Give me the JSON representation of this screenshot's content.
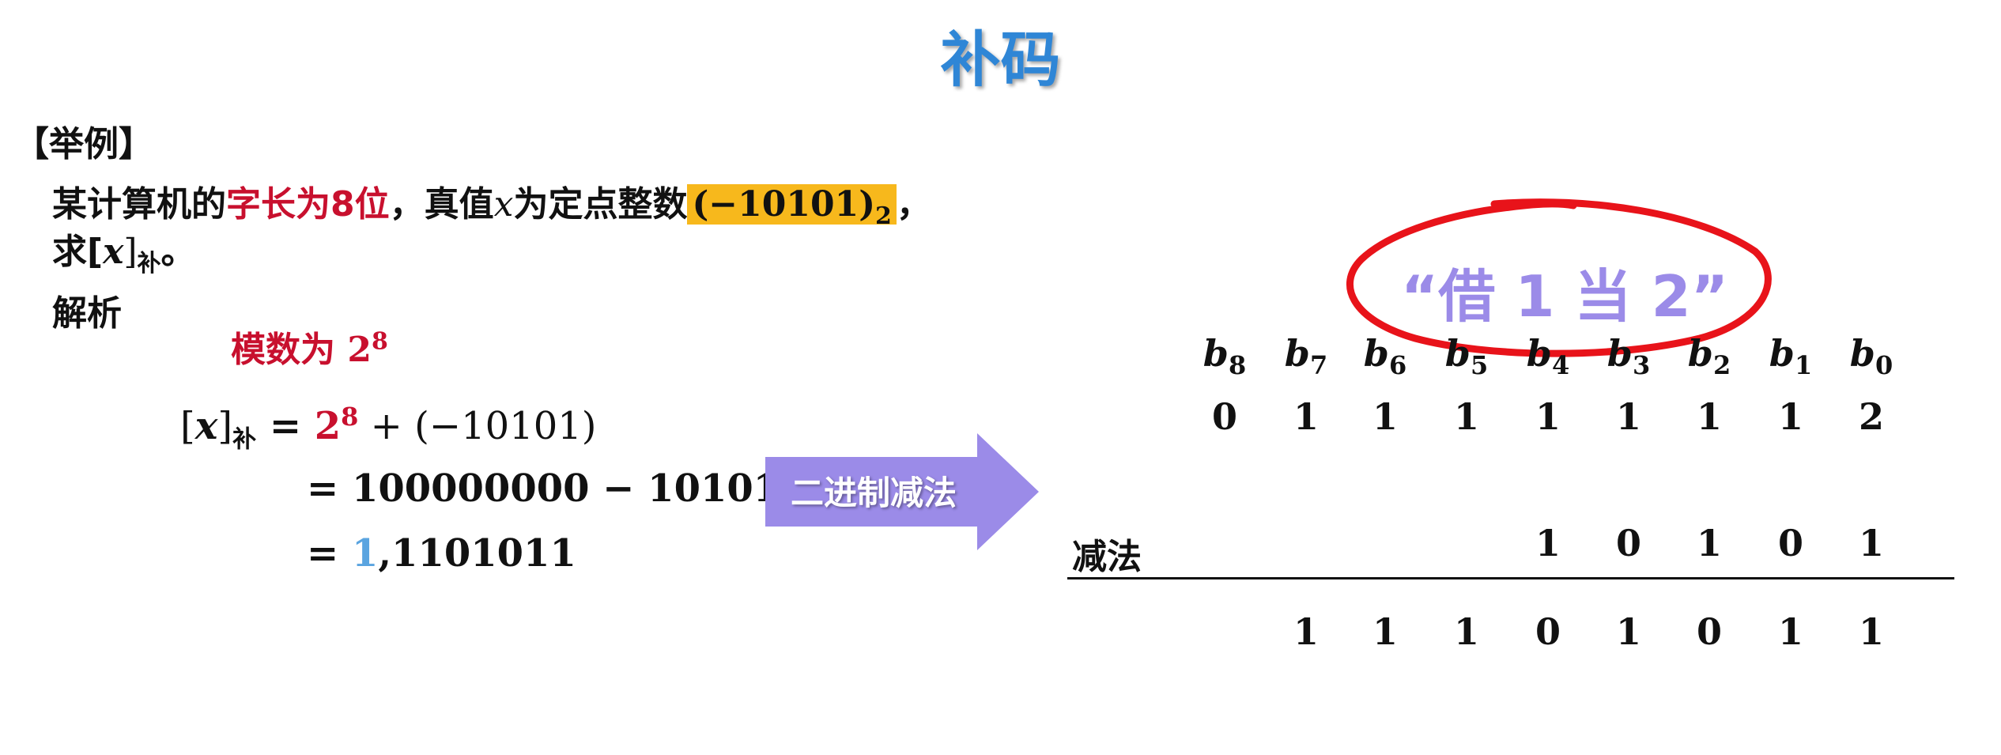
{
  "title": "补码",
  "example_label": "【举例】",
  "problem": {
    "p1": "某计算机的",
    "p2": "字长为8位",
    "p3": "，真值",
    "p4": "x",
    "p5": "为定点整数",
    "p6": "(−10101)",
    "p6_sub": "2",
    "p7": "，",
    "q1": "求[",
    "q2": "x",
    "q3": "]",
    "q4": "补",
    "q5": "。"
  },
  "analysis_label": "解析",
  "modulus": {
    "text": "模数为 ",
    "base": "2",
    "exp": "8"
  },
  "derivation": {
    "lhs_open": "[",
    "lhs_var": "x",
    "lhs_close": "]",
    "lhs_sub": "补",
    "eq": "=",
    "l1_base": "2",
    "l1_exp": "8",
    "l1_rest": " + (−10101)",
    "l2": "100000000 − 10101",
    "l3_sign": "1",
    "l3_rest": ",1101011"
  },
  "arrow": {
    "label": "二进制减法",
    "color": "#9b8be8"
  },
  "borrow_note": "“借 1 当 2”",
  "bits": {
    "labels": [
      "b",
      "b",
      "b",
      "b",
      "b",
      "b",
      "b",
      "b",
      "b"
    ],
    "subs": [
      "8",
      "7",
      "6",
      "5",
      "4",
      "3",
      "2",
      "1",
      "0"
    ],
    "borrow_row": [
      "0",
      "1",
      "1",
      "1",
      "1",
      "1",
      "1",
      "1",
      "2"
    ],
    "subtract_label": "减法",
    "subtrahend": [
      "1",
      "0",
      "1",
      "0",
      "1"
    ],
    "result": [
      "1",
      "1",
      "1",
      "0",
      "1",
      "0",
      "1",
      "1"
    ]
  }
}
